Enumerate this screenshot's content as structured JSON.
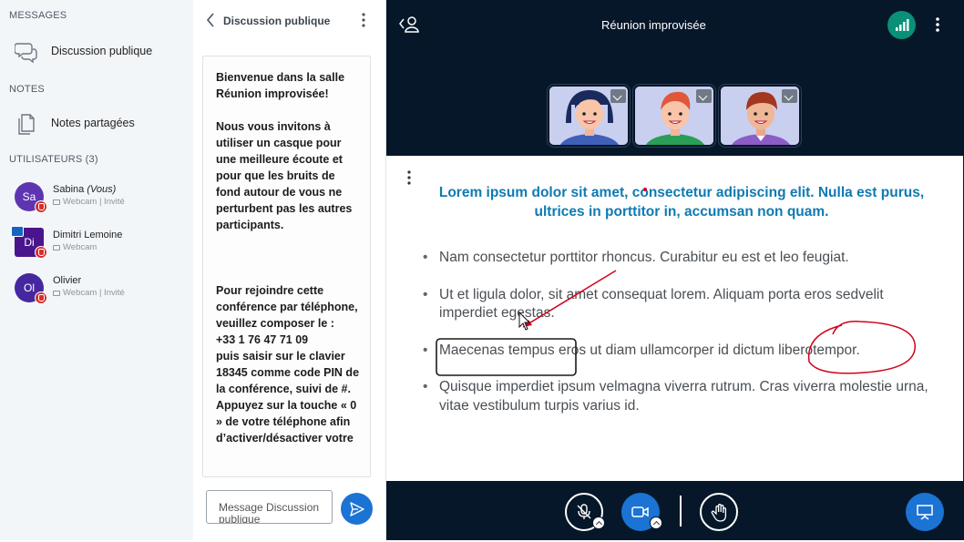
{
  "nav": {
    "messages_heading": "MESSAGES",
    "public_chat_label": "Discussion publique",
    "notes_heading": "NOTES",
    "shared_notes_label": "Notes partagées",
    "users_heading": "UTILISATEURS (3)",
    "users": [
      {
        "initials": "Sa",
        "name": "Sabina",
        "you_tag": "(Vous)",
        "status": "Webcam | Invité",
        "avatar_color": "#5e35b1",
        "presenter": false
      },
      {
        "initials": "Di",
        "name": "Dimitri Lemoine",
        "you_tag": "",
        "status": "Webcam",
        "avatar_color": "#4a148c",
        "presenter": true
      },
      {
        "initials": "Ol",
        "name": "Olivier",
        "you_tag": "",
        "status": "Webcam | Invité",
        "avatar_color": "#4527a0",
        "presenter": false
      }
    ]
  },
  "chat": {
    "title": "Discussion publique",
    "welcome_line1": "Bienvenue dans la salle Réunion improvisée!",
    "welcome_line2": "Nous vous invitons à utiliser un casque pour une meilleure écoute et pour que les bruits de fond autour de vous ne perturbent pas les autres participants.",
    "phone_line1": "Pour rejoindre cette conférence par téléphone, veuillez composer le :",
    "phone_number": "+33 1 76 47 71 09",
    "phone_line2": "puis saisir sur le clavier 18345 comme code PIN de la conférence, suivi de #.",
    "phone_line3": "Appuyez sur la touche « 0 » de votre téléphone afin d’activer/désactiver votre",
    "input_placeholder": "Message Discussion publique"
  },
  "meeting": {
    "title": "Réunion improvisée",
    "connection_color": "#0a8f79",
    "accent_color": "#1b73d3"
  },
  "slide": {
    "heading": "Lorem ipsum dolor sit amet, consectetur adipiscing elit. Nulla est purus, ultrices in porttitor in, accumsan non quam.",
    "bullets": [
      "Nam consectetur porttitor rhoncus. Curabitur eu est et leo feugiat.",
      "Ut et ligula dolor, sit amet consequat lorem. Aliquam porta eros sedvelit imperdiet egestas.",
      "Maecenas tempus eros ut diam ullamcorper id dictum liberotempor.",
      "Quisque imperdiet ipsum velmagna viverra rutrum. Cras viverra molestie urna, vitae vestibulum turpis varius id."
    ]
  },
  "icons": {
    "chat": "speech-bubbles-icon",
    "notes": "document-icon",
    "mic_muted": "microphone-off-icon",
    "camera": "video-camera-icon",
    "hand": "raise-hand-icon",
    "presentation": "presentation-screen-icon",
    "send": "paper-plane-icon",
    "connection": "signal-bars-icon"
  }
}
